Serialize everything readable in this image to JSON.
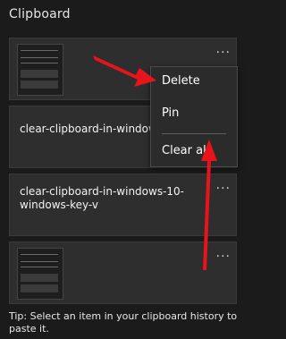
{
  "panel": {
    "title": "Clipboard"
  },
  "items": [
    {
      "type": "image",
      "more_label": "..."
    },
    {
      "type": "text",
      "text": "clear-clipboard-in-windows",
      "more_label": "..."
    },
    {
      "type": "text",
      "text": "clear-clipboard-in-windows-10-windows-key-v",
      "more_label": "..."
    },
    {
      "type": "image",
      "more_label": "..."
    }
  ],
  "context_menu": {
    "items": [
      "Delete",
      "Pin",
      "Clear all"
    ]
  },
  "tip": "Tip: Select an item in your clipboard history to paste it.",
  "colors": {
    "background": "#1b1b1b",
    "card": "#2e2e2e",
    "menu": "#2b2b2b",
    "annotation_arrow": "#e8141b"
  }
}
